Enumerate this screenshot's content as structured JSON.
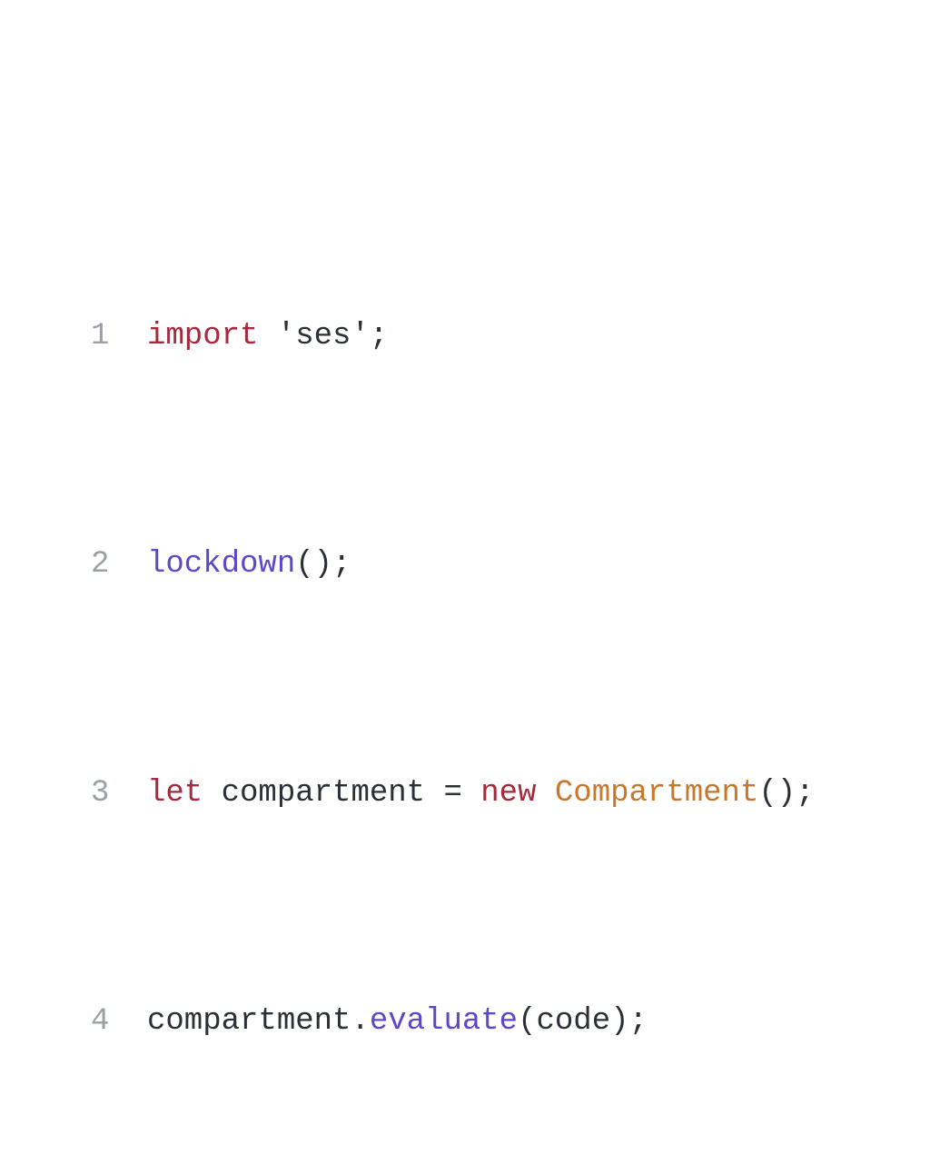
{
  "code": {
    "lines": [
      {
        "num": "1",
        "tokens": {
          "import_kw": "import",
          "sp1": " ",
          "q1": "'",
          "str": "ses",
          "q2": "'",
          "semi": ";"
        }
      },
      {
        "num": "2",
        "tokens": {
          "fn": "lockdown",
          "paren_open": "(",
          "paren_close": ")",
          "semi": ";"
        }
      },
      {
        "num": "3",
        "tokens": {
          "let_kw": "let",
          "sp1": " ",
          "var": "compartment",
          "sp2": " ",
          "eq": "=",
          "sp3": " ",
          "new_kw": "new",
          "sp4": " ",
          "cls": "Compartment",
          "paren_open": "(",
          "paren_close": ")",
          "semi": ";"
        }
      },
      {
        "num": "4",
        "tokens": {
          "obj": "compartment",
          "dot": ".",
          "method": "evaluate",
          "paren_open": "(",
          "arg": "code",
          "paren_close": ")",
          "semi": ";"
        }
      }
    ]
  }
}
